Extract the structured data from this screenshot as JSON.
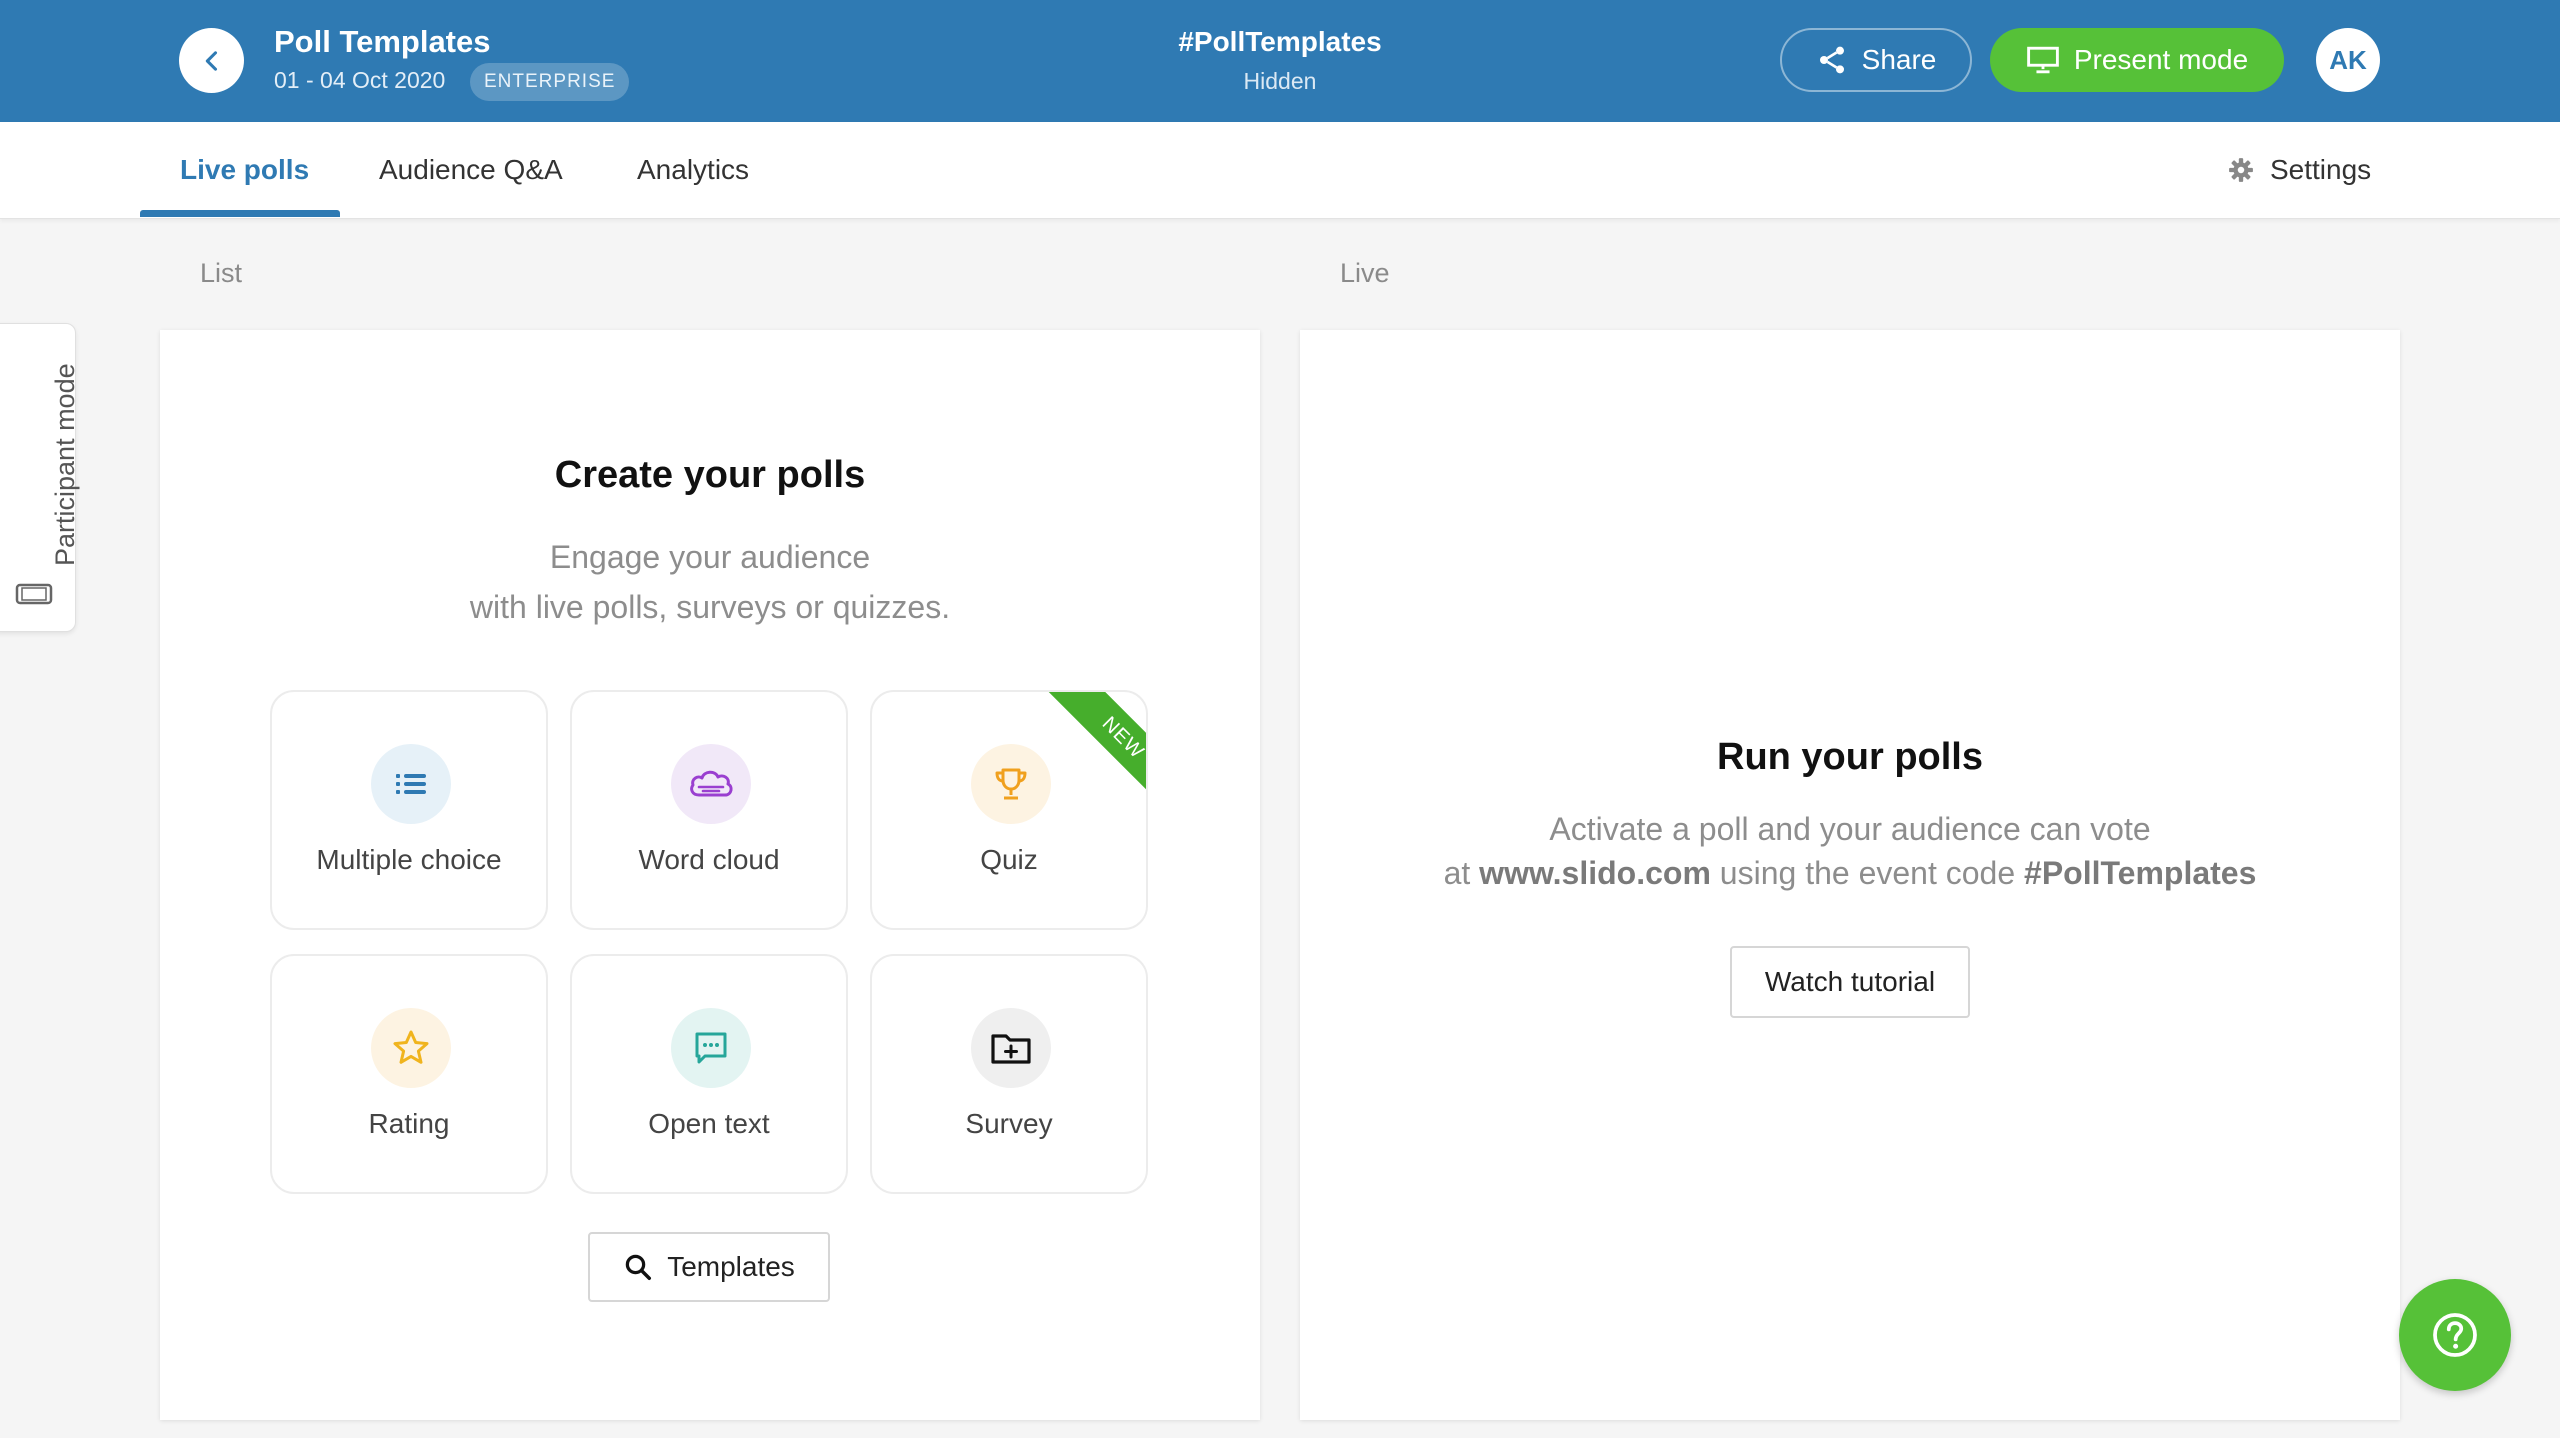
{
  "header": {
    "event_title": "Poll Templates",
    "event_dates": "01 - 04 Oct 2020",
    "plan_badge": "ENTERPRISE",
    "event_code": "#PollTemplates",
    "event_visibility": "Hidden",
    "share_label": "Share",
    "present_label": "Present mode",
    "avatar_initials": "AK"
  },
  "tabs": [
    {
      "label": "Live polls",
      "active": true
    },
    {
      "label": "Audience Q&A",
      "active": false
    },
    {
      "label": "Analytics",
      "active": false
    }
  ],
  "settings_label": "Settings",
  "participant_mode_label": "Participant mode",
  "sections": {
    "list": "List",
    "live": "Live"
  },
  "create_panel": {
    "title": "Create your polls",
    "subtitle_line1": "Engage your audience",
    "subtitle_line2": "with live polls, surveys or quizzes.",
    "poll_types": [
      {
        "label": "Multiple choice",
        "icon": "list-icon"
      },
      {
        "label": "Word cloud",
        "icon": "cloud-icon"
      },
      {
        "label": "Quiz",
        "icon": "trophy-icon",
        "ribbon": "NEW"
      },
      {
        "label": "Rating",
        "icon": "star-icon"
      },
      {
        "label": "Open text",
        "icon": "chat-bubble-icon"
      },
      {
        "label": "Survey",
        "icon": "folder-plus-icon"
      }
    ],
    "templates_label": "Templates"
  },
  "run_panel": {
    "title": "Run your polls",
    "line1": "Activate a poll and your audience can vote",
    "line2_prefix": "at",
    "line2_url": "www.slido.com",
    "line2_middle": "using the event code",
    "line2_code": "#PollTemplates",
    "tutorial_label": "Watch tutorial"
  },
  "colors": {
    "header_blue": "#2f7ab3",
    "accent_green": "#56c138",
    "ribbon_green": "#46ae2c"
  }
}
